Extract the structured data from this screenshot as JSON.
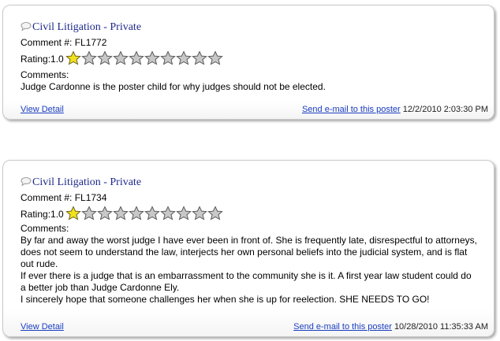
{
  "colors": {
    "link": "#1a3ec0",
    "title": "#1e2a8a",
    "star_filled": "#f2e21c",
    "star_empty": "#c8c8c8"
  },
  "icons": {
    "comment": "speech-bubble-icon",
    "star": "star-icon"
  },
  "comments": [
    {
      "title": "Civil Litigation - Private",
      "comment_number": "Comment #: FL1772",
      "rating_label": "Rating:1.0",
      "rating_value": 1.0,
      "rating_max": 10,
      "comments_label": "Comments:",
      "paragraphs": [
        "Judge Cardonne is the poster child for why judges should not be elected."
      ],
      "view_detail": "View Detail",
      "send_email": "Send e-mail to this poster",
      "timestamp": "12/2/2010 2:03:30 PM"
    },
    {
      "title": "Civil Litigation - Private",
      "comment_number": "Comment #: FL1734",
      "rating_label": "Rating:1.0",
      "rating_value": 1.0,
      "rating_max": 10,
      "comments_label": "Comments:",
      "paragraphs": [
        "By far and away the worst judge I have ever been in front of. She is frequently late, disrespectful to attorneys, does not seem to understand the law, interjects her own personal beliefs into the judicial system, and is flat out rude.",
        "If ever there is a judge that is an embarrassment to the community she is it. A first year law student could do a better job than Judge Cardonne Ely.",
        "I sincerely hope that someone challenges her when she is up for reelection. SHE NEEDS TO GO!"
      ],
      "view_detail": "View Detail",
      "send_email": "Send e-mail to this poster",
      "timestamp": "10/28/2010 11:35:33 AM"
    }
  ]
}
